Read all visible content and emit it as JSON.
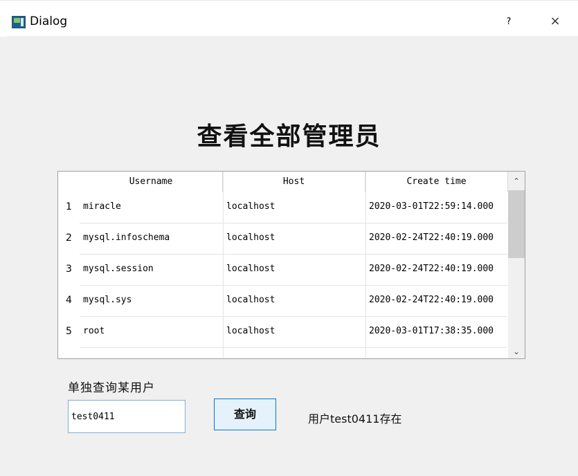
{
  "window": {
    "title": "Dialog",
    "help_label": "?",
    "close_label": "×"
  },
  "main": {
    "heading": "查看全部管理员"
  },
  "table": {
    "columns": [
      "Username",
      "Host",
      "Create time"
    ],
    "rows": [
      {
        "num": "1",
        "username": "miracle",
        "host": "localhost",
        "create_time": "2020-03-01T22:59:14.000"
      },
      {
        "num": "2",
        "username": "mysql.infoschema",
        "host": "localhost",
        "create_time": "2020-02-24T22:40:19.000"
      },
      {
        "num": "3",
        "username": "mysql.session",
        "host": "localhost",
        "create_time": "2020-02-24T22:40:19.000"
      },
      {
        "num": "4",
        "username": "mysql.sys",
        "host": "localhost",
        "create_time": "2020-02-24T22:40:19.000"
      },
      {
        "num": "5",
        "username": "root",
        "host": "localhost",
        "create_time": "2020-03-01T17:38:35.000"
      }
    ],
    "scroll_up": "⌃",
    "scroll_down": "⌄"
  },
  "search": {
    "label": "单独查询某用户",
    "value": "test0411",
    "button_label": "查询",
    "status": "用户test0411存在"
  },
  "colors": {
    "accent": "#0078d7",
    "button_bg": "#e5f1fb",
    "window_bg": "#f0f0f0"
  }
}
